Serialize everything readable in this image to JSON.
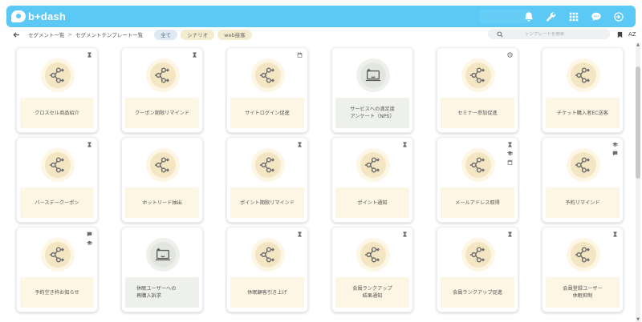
{
  "app": {
    "logo_text": "b+dash"
  },
  "header_icons": [
    "bell-icon",
    "wrench-icon",
    "apps-grid-icon",
    "chat-icon",
    "logout-icon"
  ],
  "breadcrumb": {
    "item1": "セグメント一覧",
    "sep": ">",
    "item2": "セグメントテンプレート一覧"
  },
  "filters": [
    {
      "label": "全て",
      "active": true
    },
    {
      "label": "シナリオ",
      "active": false
    },
    {
      "label": "web接客",
      "active": false
    }
  ],
  "search": {
    "placeholder": "テンプレートを検索"
  },
  "sort": {
    "az_label": "AZ"
  },
  "colors": {
    "topbar": "#5bc8f5",
    "label_bg": "#fdf6e4",
    "neutral_label_bg": "#eef0ec"
  },
  "cards": [
    {
      "label": "クロスセル商品紹介",
      "icon": "flow-icon",
      "badges": [
        "hourglass-icon"
      ]
    },
    {
      "label": "クーポン期限リマインド",
      "icon": "flow-icon",
      "badges": [
        "hourglass-icon"
      ]
    },
    {
      "label": "サイトログイン促進",
      "icon": "flow-icon",
      "badges": [
        "calendar-icon"
      ]
    },
    {
      "label": "サービスへの満足度\nアンケート（NPS）",
      "icon": "survey-icon",
      "badges": []
    },
    {
      "label": "セミナー参加促進",
      "icon": "flow-icon",
      "badges": [
        "clock-icon"
      ]
    },
    {
      "label": "チケット購入者EC送客",
      "icon": "flow-icon",
      "badges": []
    },
    {
      "label": "バースデークーポン",
      "icon": "flow-icon",
      "badges": [
        "hourglass-icon"
      ]
    },
    {
      "label": "ホットリード抽出",
      "icon": "flow-icon",
      "badges": []
    },
    {
      "label": "ポイント期限リマインド",
      "icon": "flow-icon",
      "badges": [
        "hourglass-icon"
      ]
    },
    {
      "label": "ポイント通知",
      "icon": "flow-icon",
      "badges": [
        "hourglass-icon"
      ]
    },
    {
      "label": "メールアドレス取得",
      "icon": "flow-icon",
      "badges": [
        "hourglass-icon",
        "graduation-icon",
        "calendar-icon"
      ]
    },
    {
      "label": "予約リマインド",
      "icon": "flow-icon",
      "badges": [
        "graduation-icon",
        "chat-icon"
      ]
    },
    {
      "label": "予約空き枠お知らせ",
      "icon": "flow-icon",
      "badges": [
        "chat-icon",
        "graduation-icon"
      ]
    },
    {
      "label": "休眠ユーザーへの\n再購入訴求",
      "icon": "survey-icon",
      "badges": []
    },
    {
      "label": "休眠顧客引き上げ",
      "icon": "flow-icon",
      "badges": [
        "hourglass-icon"
      ]
    },
    {
      "label": "会員ランクアップ\n結果通知",
      "icon": "flow-icon",
      "badges": [
        "hourglass-icon"
      ]
    },
    {
      "label": "会員ランクアップ促進",
      "icon": "flow-icon",
      "badges": [
        "hourglass-icon"
      ]
    },
    {
      "label": "会員登録ユーザー\n休眠抑制",
      "icon": "flow-icon",
      "badges": [
        "hourglass-icon"
      ]
    }
  ]
}
